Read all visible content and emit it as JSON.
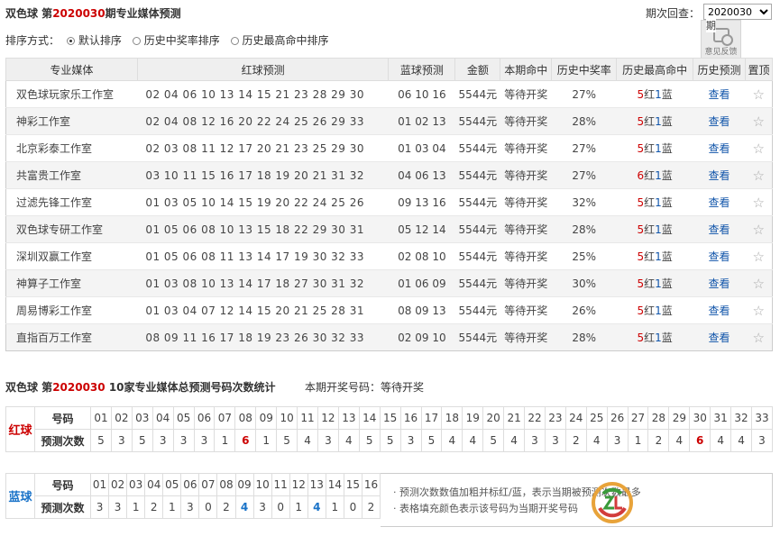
{
  "header": {
    "title_prefix": "双色球 第",
    "period": "2020030",
    "title_suffix": "期专业媒体预测",
    "period_label": "期次回查：",
    "period_value": "2020030"
  },
  "feedback": {
    "top_text": "期",
    "label": "意见反馈"
  },
  "sort": {
    "label": "排序方式：",
    "options": [
      "默认排序",
      "历史中奖率排序",
      "历史最高命中排序"
    ],
    "selected": 0
  },
  "table": {
    "headers": [
      "专业媒体",
      "红球预测",
      "蓝球预测",
      "金额",
      "本期命中",
      "历史中奖率",
      "历史最高命中",
      "历史预测",
      "置顶"
    ],
    "rows": [
      {
        "media": "双色球玩家乐工作室",
        "red": "02 04 06 10 13 14 15 21 23 28 29 30",
        "blue": "06 10 16",
        "amount": "5544元",
        "hit": "等待开奖",
        "rate": "27%",
        "best_red": "5",
        "best_red_lbl": "红",
        "best_blue": "1",
        "best_blue_lbl": "蓝",
        "view": "查看"
      },
      {
        "media": "神彩工作室",
        "red": "02 04 08 12 16 20 22 24 25 26 29 33",
        "blue": "01 02 13",
        "amount": "5544元",
        "hit": "等待开奖",
        "rate": "28%",
        "best_red": "5",
        "best_red_lbl": "红",
        "best_blue": "1",
        "best_blue_lbl": "蓝",
        "view": "查看"
      },
      {
        "media": "北京彩泰工作室",
        "red": "02 03 08 11 12 17 20 21 23 25 29 30",
        "blue": "01 03 04",
        "amount": "5544元",
        "hit": "等待开奖",
        "rate": "27%",
        "best_red": "5",
        "best_red_lbl": "红",
        "best_blue": "1",
        "best_blue_lbl": "蓝",
        "view": "查看"
      },
      {
        "media": "共富贵工作室",
        "red": "03 10 11 15 16 17 18 19 20 21 31 32",
        "blue": "04 06 13",
        "amount": "5544元",
        "hit": "等待开奖",
        "rate": "27%",
        "best_red": "6",
        "best_red_lbl": "红",
        "best_blue": "1",
        "best_blue_lbl": "蓝",
        "view": "查看"
      },
      {
        "media": "过滤先锋工作室",
        "red": "01 03 05 10 14 15 19 20 22 24 25 26",
        "blue": "09 13 16",
        "amount": "5544元",
        "hit": "等待开奖",
        "rate": "32%",
        "best_red": "5",
        "best_red_lbl": "红",
        "best_blue": "1",
        "best_blue_lbl": "蓝",
        "view": "查看"
      },
      {
        "media": "双色球专研工作室",
        "red": "01 05 06 08 10 13 15 18 22 29 30 31",
        "blue": "05 12 14",
        "amount": "5544元",
        "hit": "等待开奖",
        "rate": "28%",
        "best_red": "5",
        "best_red_lbl": "红",
        "best_blue": "1",
        "best_blue_lbl": "蓝",
        "view": "查看"
      },
      {
        "media": "深圳双赢工作室",
        "red": "01 05 06 08 11 13 14 17 19 30 32 33",
        "blue": "02 08 10",
        "amount": "5544元",
        "hit": "等待开奖",
        "rate": "25%",
        "best_red": "5",
        "best_red_lbl": "红",
        "best_blue": "1",
        "best_blue_lbl": "蓝",
        "view": "查看"
      },
      {
        "media": "神算子工作室",
        "red": "01 03 08 10 13 14 17 18 27 30 31 32",
        "blue": "01 06 09",
        "amount": "5544元",
        "hit": "等待开奖",
        "rate": "30%",
        "best_red": "5",
        "best_red_lbl": "红",
        "best_blue": "1",
        "best_blue_lbl": "蓝",
        "view": "查看"
      },
      {
        "media": "周易博彩工作室",
        "red": "01 03 04 07 12 14 15 20 21 25 28 31",
        "blue": "08 09 13",
        "amount": "5544元",
        "hit": "等待开奖",
        "rate": "26%",
        "best_red": "5",
        "best_red_lbl": "红",
        "best_blue": "1",
        "best_blue_lbl": "蓝",
        "view": "查看"
      },
      {
        "media": "直指百万工作室",
        "red": "08 09 11 16 17 18 19 23 26 30 32 33",
        "blue": "02 09 10",
        "amount": "5544元",
        "hit": "等待开奖",
        "rate": "28%",
        "best_red": "5",
        "best_red_lbl": "红",
        "best_blue": "1",
        "best_blue_lbl": "蓝",
        "view": "查看"
      }
    ]
  },
  "stats": {
    "title_prefix": "双色球 第",
    "period": "2020030",
    "title_suffix": " 10家专业媒体总预测号码次数统计",
    "draw_label": "本期开奖号码：等待开奖",
    "row_label_num": "号码",
    "row_label_cnt": "预测次数",
    "red_side": "红球",
    "blue_side": "蓝球",
    "red_nums": [
      "01",
      "02",
      "03",
      "04",
      "05",
      "06",
      "07",
      "08",
      "09",
      "10",
      "11",
      "12",
      "13",
      "14",
      "15",
      "16",
      "17",
      "18",
      "19",
      "20",
      "21",
      "22",
      "23",
      "24",
      "25",
      "26",
      "27",
      "28",
      "29",
      "30",
      "31",
      "32",
      "33"
    ],
    "red_counts": [
      "5",
      "3",
      "5",
      "3",
      "3",
      "3",
      "1",
      "6",
      "1",
      "5",
      "4",
      "3",
      "4",
      "5",
      "5",
      "3",
      "5",
      "4",
      "4",
      "5",
      "4",
      "3",
      "3",
      "2",
      "4",
      "3",
      "1",
      "2",
      "4",
      "6",
      "4",
      "4",
      "3"
    ],
    "red_hot": [
      7,
      29
    ],
    "blue_nums": [
      "01",
      "02",
      "03",
      "04",
      "05",
      "06",
      "07",
      "08",
      "09",
      "10",
      "11",
      "12",
      "13",
      "14",
      "15",
      "16"
    ],
    "blue_counts": [
      "3",
      "3",
      "1",
      "2",
      "1",
      "3",
      "0",
      "2",
      "4",
      "3",
      "0",
      "1",
      "4",
      "1",
      "0",
      "2"
    ],
    "blue_hot": [
      8,
      12
    ],
    "notes": [
      "· 预测次数数值加粗并标红/蓝，表示当期被预测次数最多",
      "· 表格填充颜色表示该号码为当期开奖号码"
    ]
  },
  "colors": {
    "red": "#cc0000",
    "blue": "#1155aa",
    "header_bg": "#efefef",
    "alt_row": "#f4f4f4"
  }
}
